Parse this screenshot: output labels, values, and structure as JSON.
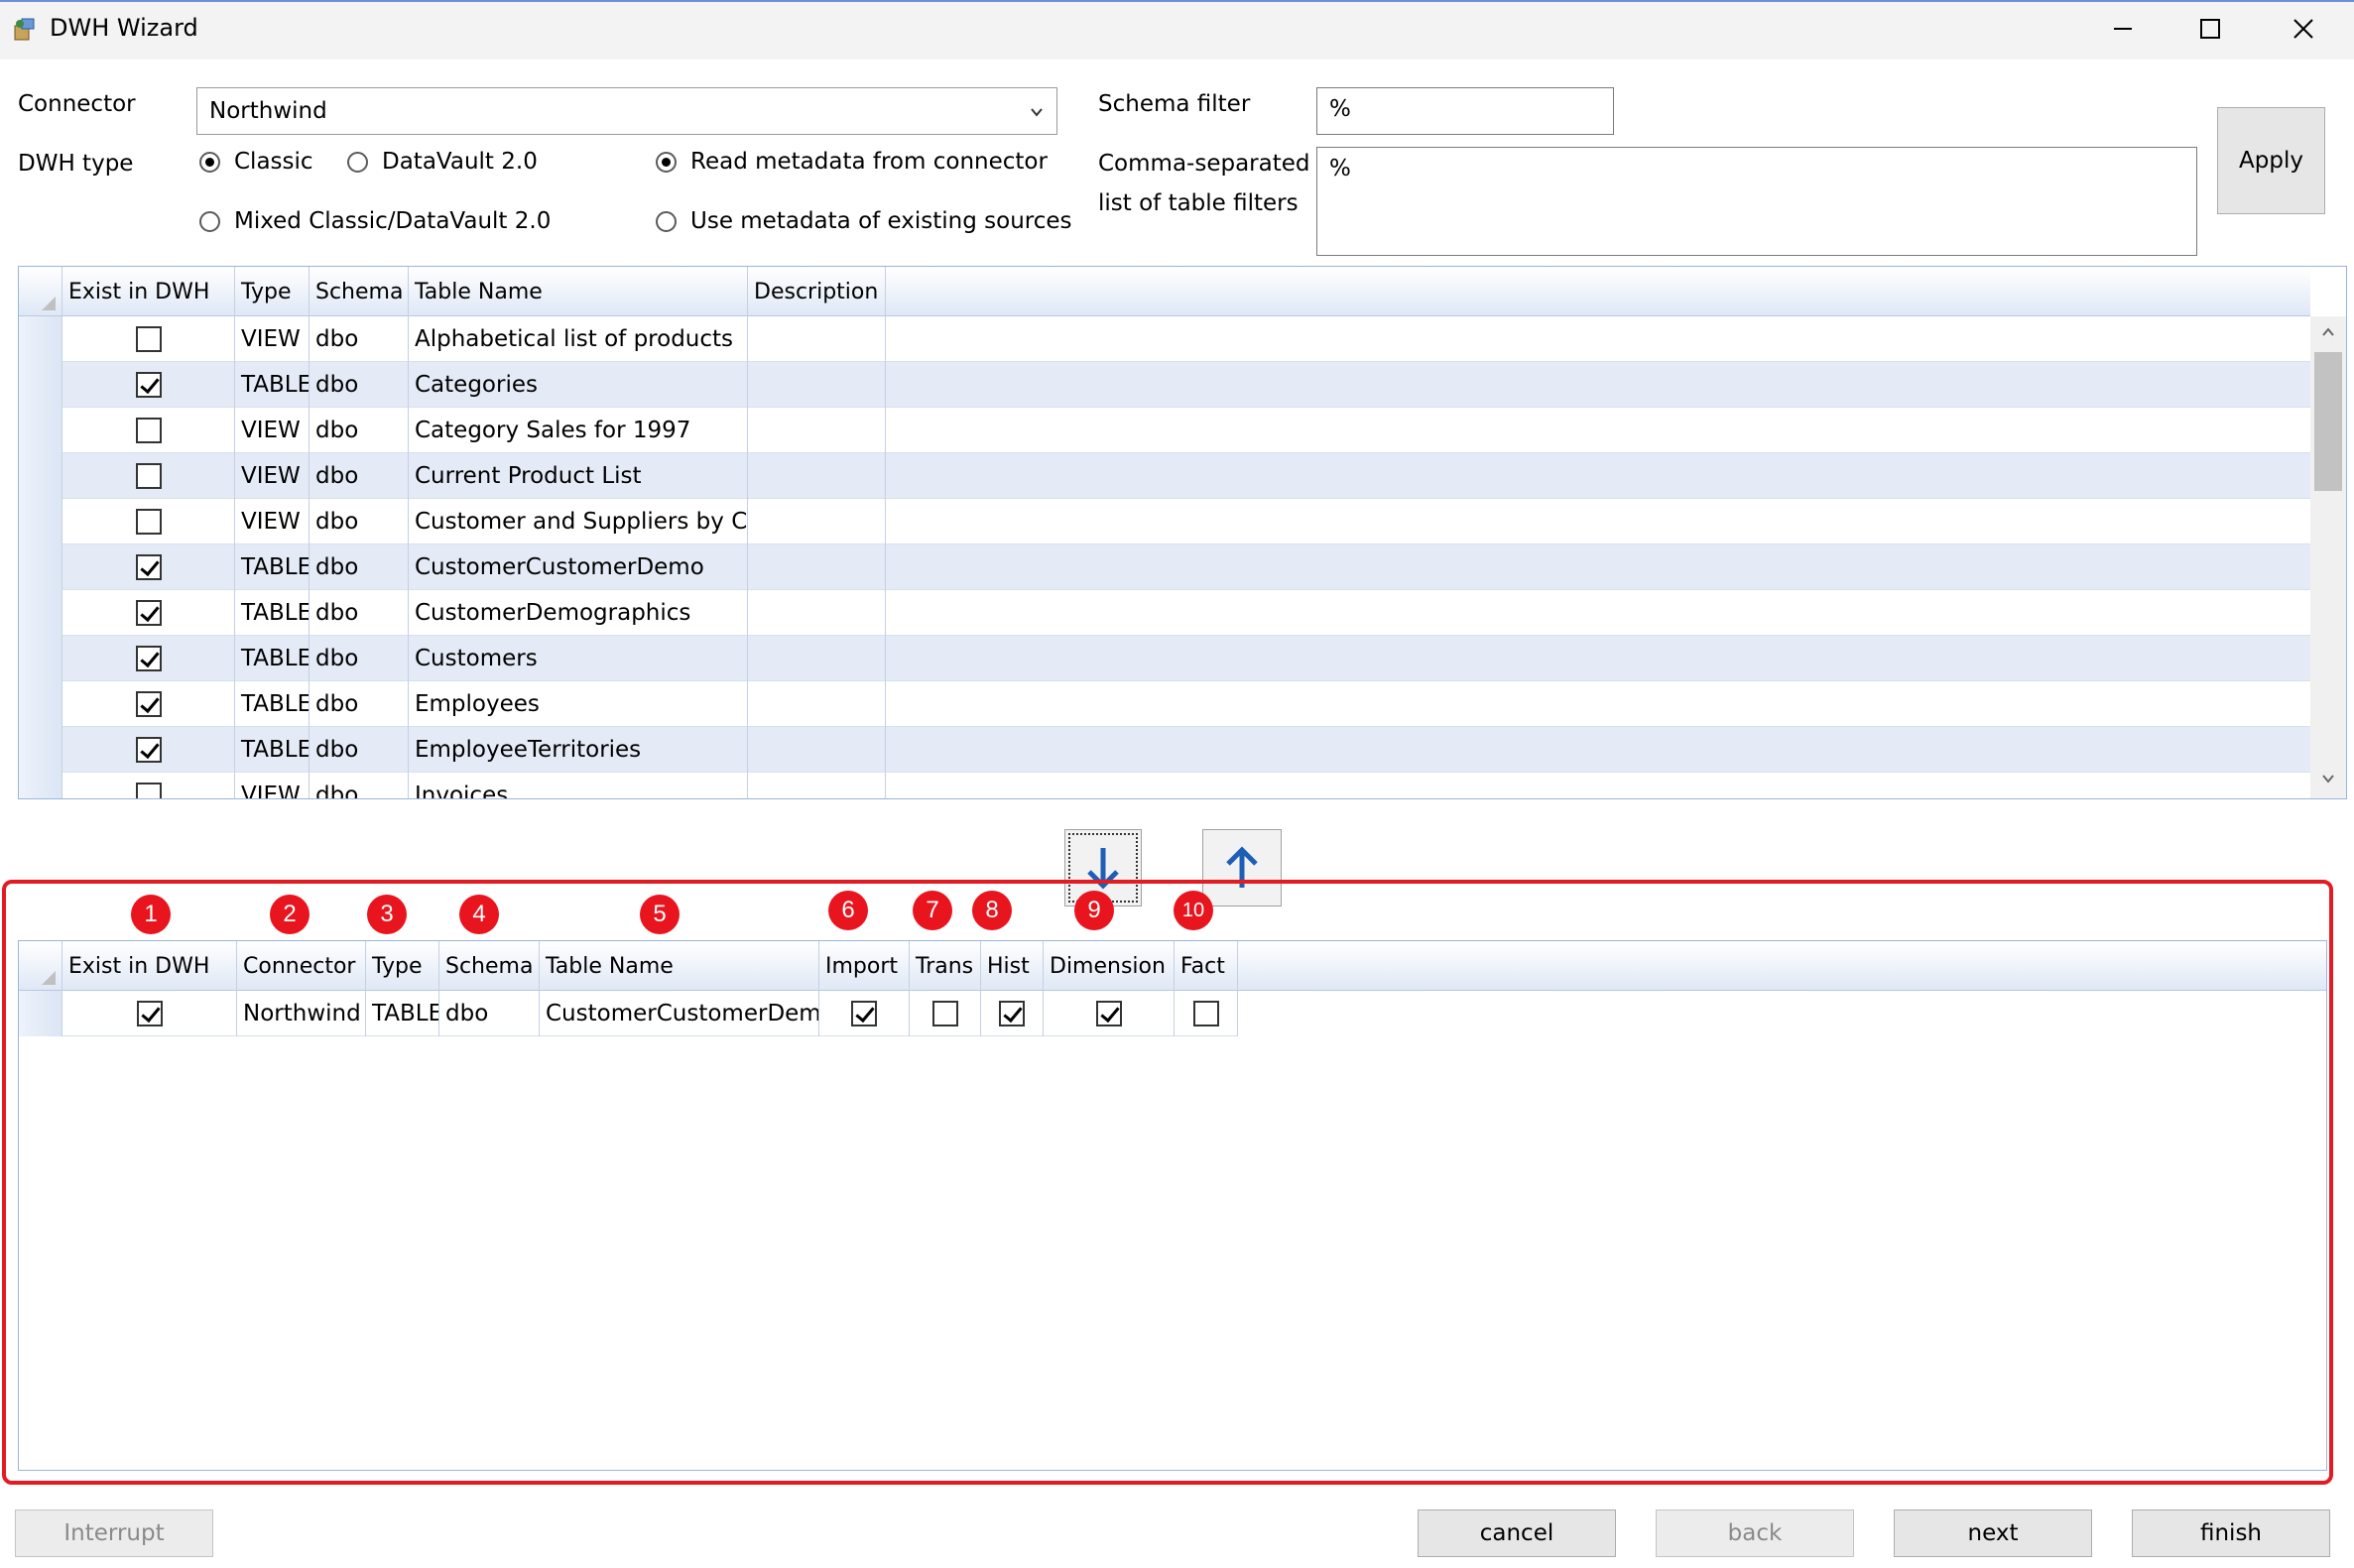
{
  "window": {
    "title": "DWH Wizard",
    "icons": [
      "app-icon",
      "minimize-icon",
      "maximize-icon",
      "close-icon"
    ]
  },
  "form": {
    "connector_label": "Connector",
    "connector_value": "Northwind",
    "dwh_type_label": "DWH type",
    "dwh_types": [
      {
        "label": "Classic",
        "selected": true
      },
      {
        "label": "DataVault 2.0",
        "selected": false
      },
      {
        "label": "Mixed Classic/DataVault 2.0",
        "selected": false
      }
    ],
    "metadata_options": [
      {
        "label": "Read metadata from connector",
        "selected": true
      },
      {
        "label": "Use metadata of existing sources",
        "selected": false
      }
    ],
    "schema_filter_label": "Schema filter",
    "schema_filter_value": "%",
    "table_filters_label_line1": "Comma-separated",
    "table_filters_label_line2": "list of table filters",
    "table_filters_value": "%",
    "apply_label": "Apply"
  },
  "source_grid": {
    "columns": [
      "Exist in DWH",
      "Type",
      "Schema",
      "Table Name",
      "Description"
    ],
    "rows": [
      {
        "exist": false,
        "type": "VIEW",
        "schema": "dbo",
        "name": "Alphabetical list of products"
      },
      {
        "exist": true,
        "type": "TABLE",
        "schema": "dbo",
        "name": "Categories"
      },
      {
        "exist": false,
        "type": "VIEW",
        "schema": "dbo",
        "name": "Category Sales for 1997"
      },
      {
        "exist": false,
        "type": "VIEW",
        "schema": "dbo",
        "name": "Current Product List"
      },
      {
        "exist": false,
        "type": "VIEW",
        "schema": "dbo",
        "name": "Customer and Suppliers by City"
      },
      {
        "exist": true,
        "type": "TABLE",
        "schema": "dbo",
        "name": "CustomerCustomerDemo"
      },
      {
        "exist": true,
        "type": "TABLE",
        "schema": "dbo",
        "name": "CustomerDemographics"
      },
      {
        "exist": true,
        "type": "TABLE",
        "schema": "dbo",
        "name": "Customers"
      },
      {
        "exist": true,
        "type": "TABLE",
        "schema": "dbo",
        "name": "Employees"
      },
      {
        "exist": true,
        "type": "TABLE",
        "schema": "dbo",
        "name": "EmployeeTerritories"
      },
      {
        "exist": false,
        "type": "VIEW",
        "schema": "dbo",
        "name": "Invoices"
      }
    ]
  },
  "transfer": {
    "down_icon": "arrow-down-icon",
    "up_icon": "arrow-up-icon"
  },
  "selected_grid": {
    "columns": [
      "Exist in DWH",
      "Connector",
      "Type",
      "Schema",
      "Table Name",
      "Import",
      "Trans",
      "Hist",
      "Dimension",
      "Fact"
    ],
    "badges": [
      "1",
      "2",
      "3",
      "4",
      "5",
      "6",
      "7",
      "8",
      "9",
      "10"
    ],
    "rows": [
      {
        "exist": true,
        "connector": "Northwind",
        "type": "TABLE",
        "schema": "dbo",
        "name": "CustomerCustomerDemo",
        "import": true,
        "trans": false,
        "hist": true,
        "dimension": true,
        "fact": false
      }
    ]
  },
  "footer": {
    "interrupt_label": "Interrupt",
    "cancel_label": "cancel",
    "back_label": "back",
    "next_label": "next",
    "finish_label": "finish"
  },
  "colors": {
    "highlight": "#e31b23",
    "badge": "#e8141e",
    "arrow": "#1d5fb5",
    "grid_alt_row": "#e5ebf6"
  }
}
